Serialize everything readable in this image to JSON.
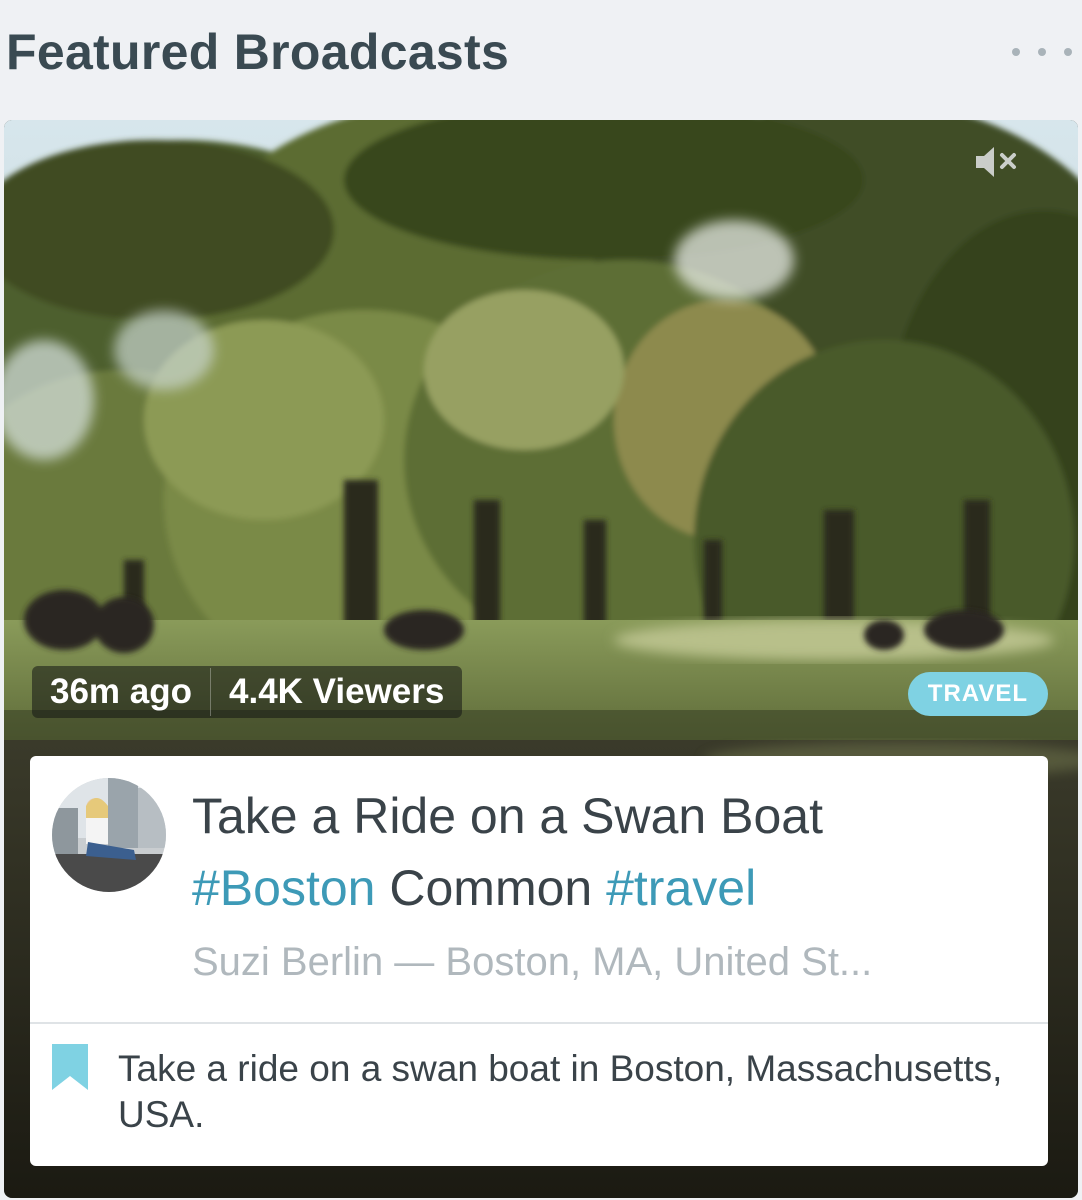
{
  "header": {
    "title": "Featured Broadcasts",
    "more_icon": "more-dots-icon"
  },
  "broadcast": {
    "mute_icon": "speaker-muted-icon",
    "time_ago": "36m ago",
    "viewers": "4.4K Viewers",
    "category": "TRAVEL",
    "title_parts": {
      "p1": "Take a Ride on a Swan Boat",
      "tag1": "#Boston",
      "p2": " Common ",
      "tag2": "#travel"
    },
    "byline": "Suzi Berlin — Boston, MA, United St...",
    "bookmark_icon": "bookmark-icon",
    "description": "Take a ride on a swan boat in Boston, Massachusetts, USA."
  },
  "colors": {
    "accent": "#3d9ab7",
    "badge": "#7fd2e3",
    "title_text": "#3a4a52",
    "muted_text": "#b0b8bd"
  }
}
